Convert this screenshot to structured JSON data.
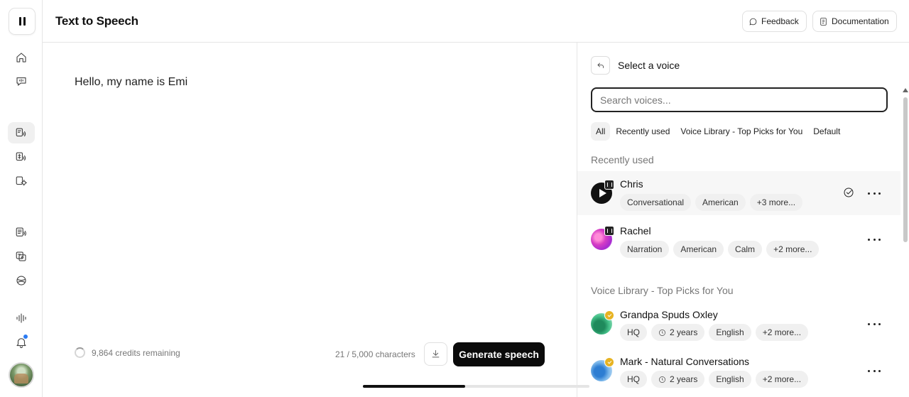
{
  "header": {
    "title": "Text to Speech",
    "feedback_label": "Feedback",
    "documentation_label": "Documentation"
  },
  "sidebar": {
    "icons": [
      "home-icon",
      "chat-bubble-icon",
      "text-to-speech-icon",
      "speech-to-speech-icon",
      "voice-settings-icon",
      "projects-icon",
      "dubbing-icon",
      "sound-effects-icon",
      "audio-waveform-icon",
      "bell-icon"
    ],
    "active_item": "text-to-speech-icon"
  },
  "editor": {
    "text": "Hello, my name is Emi",
    "credits": "9,864 credits remaining",
    "char_count": "21 / 5,000 characters",
    "generate_label": "Generate speech",
    "scroll_progress": 0.45
  },
  "voice_panel": {
    "title": "Select a voice",
    "search_placeholder": "Search voices...",
    "filters": [
      "All",
      "Recently used",
      "Voice Library - Top Picks for You",
      "Default"
    ],
    "active_filter": "All",
    "recent_label": "Recently used",
    "library_label": "Voice Library - Top Picks for You",
    "recent": [
      {
        "name": "Chris",
        "tags": [
          "Conversational",
          "American",
          "+3 more..."
        ],
        "selected": true
      },
      {
        "name": "Rachel",
        "tags": [
          "Narration",
          "American",
          "Calm",
          "+2 more..."
        ]
      }
    ],
    "library": [
      {
        "name": "Grandpa Spuds Oxley",
        "tags": [
          "HQ",
          "2 years",
          "English",
          "+2 more..."
        ]
      },
      {
        "name": "Mark - Natural Conversations",
        "tags": [
          "HQ",
          "2 years",
          "English",
          "+2 more..."
        ]
      }
    ]
  },
  "colors": {
    "primary_button": "#0b0b0b",
    "notification_dot": "#2b7bf3",
    "verified_badge": "#e7b322"
  }
}
